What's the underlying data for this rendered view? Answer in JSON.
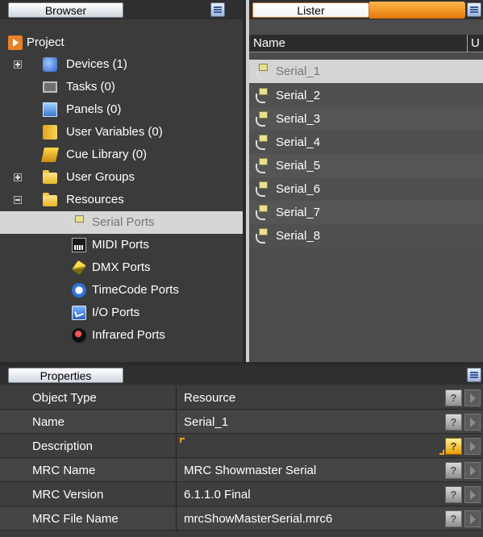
{
  "browser": {
    "title": "Browser",
    "tree": [
      {
        "label": "Project",
        "icon": "project-icon"
      },
      {
        "label": "Devices (1)",
        "icon": "devices-icon",
        "expander": "plus"
      },
      {
        "label": "Tasks (0)",
        "icon": "tasks-icon"
      },
      {
        "label": "Panels (0)",
        "icon": "panels-icon"
      },
      {
        "label": "User Variables (0)",
        "icon": "user-variables-icon"
      },
      {
        "label": "Cue Library (0)",
        "icon": "cue-library-icon"
      },
      {
        "label": "User Groups",
        "icon": "folder-icon",
        "expander": "plus"
      },
      {
        "label": "Resources",
        "icon": "folder-icon",
        "expander": "minus"
      },
      {
        "label": "Serial Ports",
        "icon": "serial-port-icon",
        "selected": true
      },
      {
        "label": "MIDI Ports",
        "icon": "midi-port-icon"
      },
      {
        "label": "DMX Ports",
        "icon": "dmx-port-icon"
      },
      {
        "label": "TimeCode Ports",
        "icon": "timecode-icon"
      },
      {
        "label": "I/O Ports",
        "icon": "io-port-icon"
      },
      {
        "label": "Infrared Ports",
        "icon": "infrared-icon"
      }
    ]
  },
  "lister": {
    "title": "Lister",
    "columns": {
      "name": "Name",
      "u": "U"
    },
    "items": [
      "Serial_1",
      "Serial_2",
      "Serial_3",
      "Serial_4",
      "Serial_5",
      "Serial_6",
      "Serial_7",
      "Serial_8"
    ],
    "selected_index": 0
  },
  "properties": {
    "title": "Properties",
    "rows": [
      {
        "key": "Object Type",
        "value": "Resource"
      },
      {
        "key": "Name",
        "value": "Serial_1"
      },
      {
        "key": "Description",
        "value": ""
      },
      {
        "key": "MRC Name",
        "value": "MRC Showmaster Serial"
      },
      {
        "key": "MRC Version",
        "value": "6.1.1.0 Final"
      },
      {
        "key": "MRC File Name",
        "value": "mrcShowMasterSerial.mrc6"
      }
    ],
    "help_glyph": "?"
  }
}
